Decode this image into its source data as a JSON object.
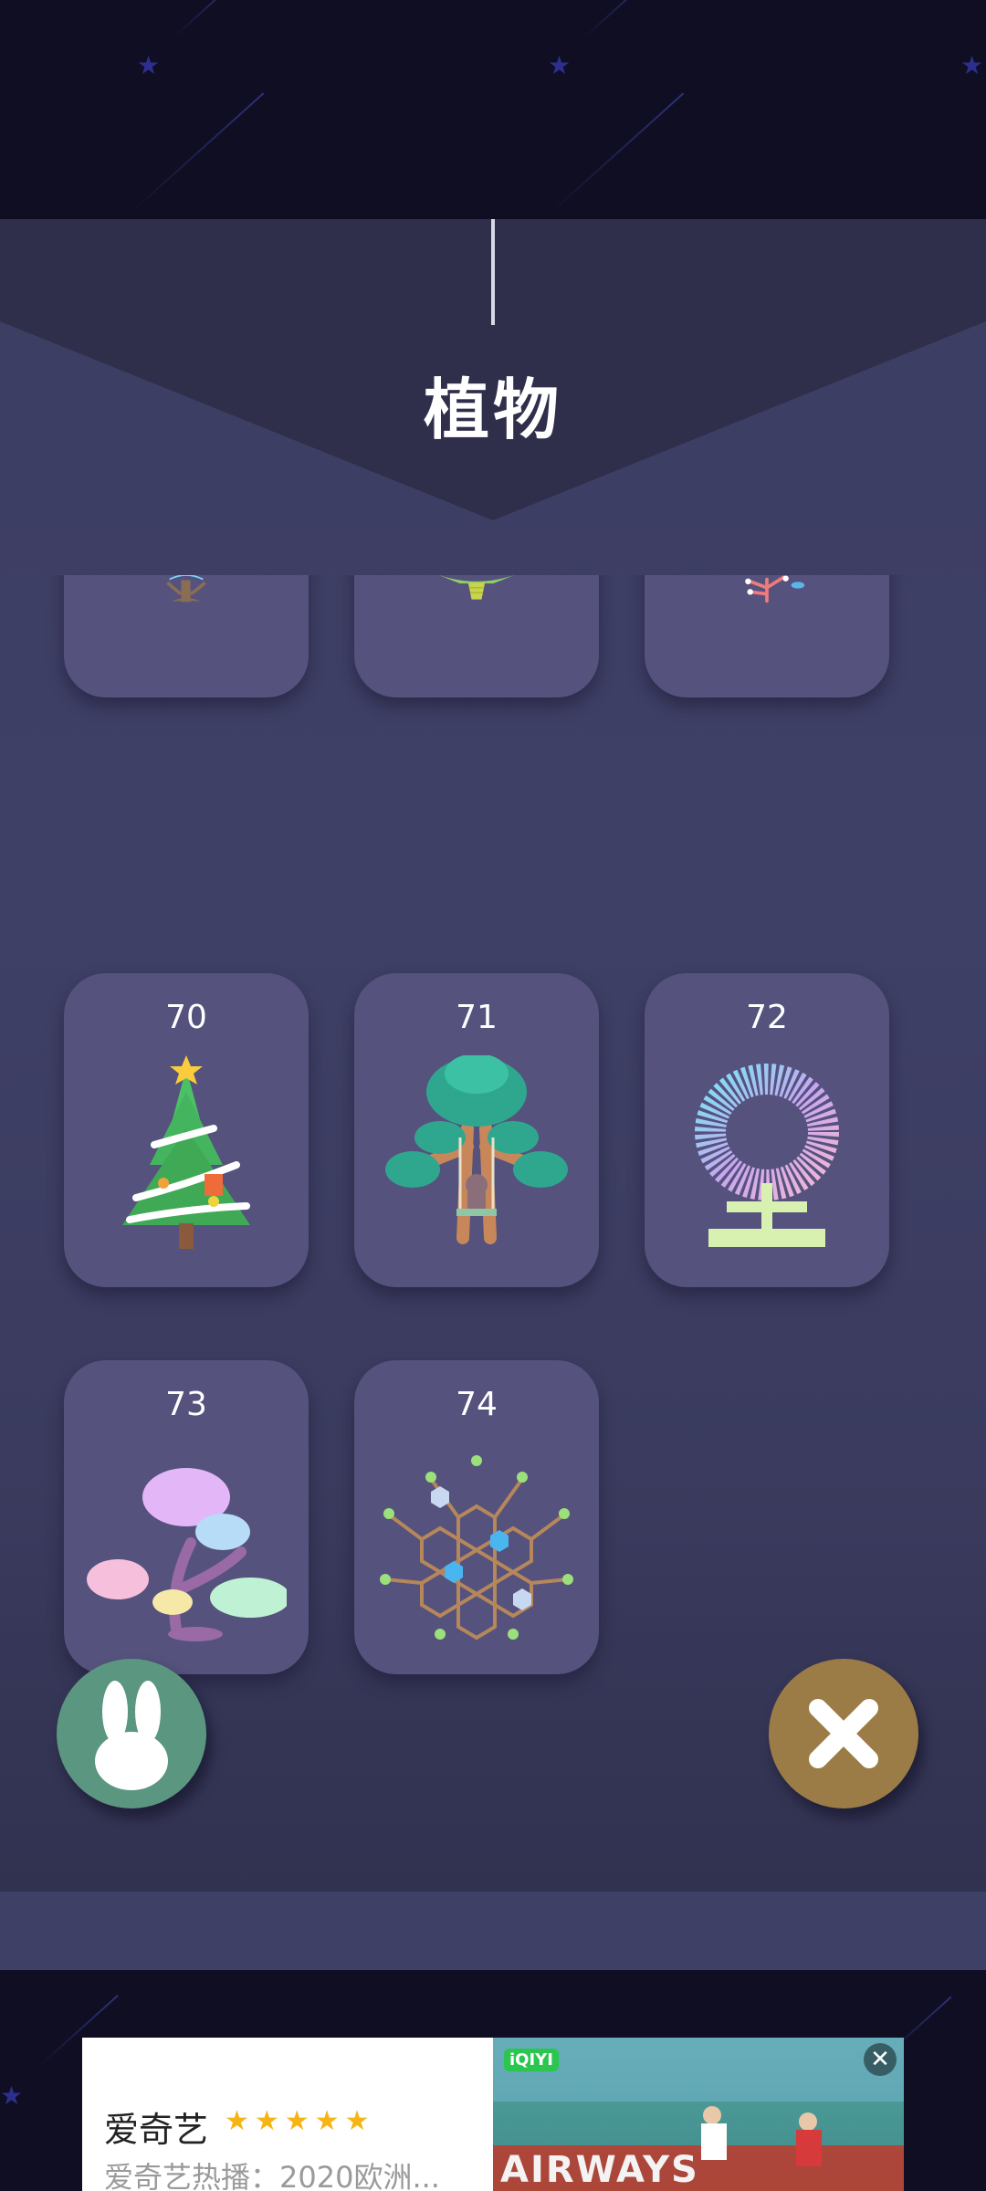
{
  "header": {
    "title": "植物"
  },
  "plants": [
    {
      "number": "70",
      "icon": "christmas-tree-icon"
    },
    {
      "number": "71",
      "icon": "swing-tree-icon"
    },
    {
      "number": "72",
      "icon": "pixel-flower-icon"
    },
    {
      "number": "73",
      "icon": "cloud-bonsai-icon"
    },
    {
      "number": "74",
      "icon": "hexagon-tree-icon"
    }
  ],
  "partial_row_icons": [
    "ferris-tree-icon",
    "fountain-plant-icon",
    "coral-tree-icon"
  ],
  "buttons": {
    "rabbit": "rabbit-icon",
    "close": "close-icon"
  },
  "ad": {
    "title": "爱奇艺",
    "stars": "★★★★★",
    "description": "爱奇艺热播：2020欧洲...",
    "video_brand": "AIRWAYS",
    "watermark": "iQIYI",
    "close_glyph": "✕"
  },
  "colors": {
    "background": "#0f0e23",
    "panel": "#3f4066",
    "card": "#55527d",
    "rabbit_button": "#5a9680",
    "close_button": "#9c7c46"
  }
}
